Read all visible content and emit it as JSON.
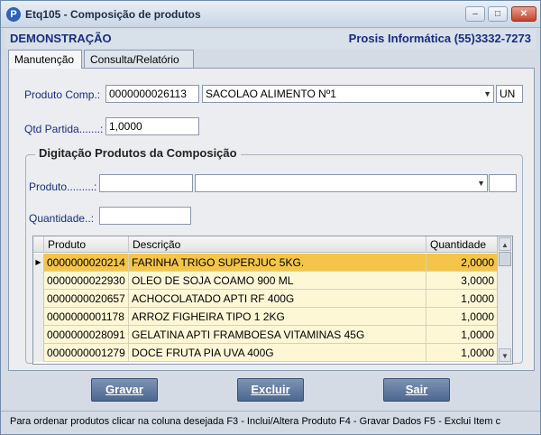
{
  "window": {
    "title": "Etq105 - Composição de produtos",
    "icon_letter": "P",
    "min": "–",
    "max": "□",
    "close": "✕"
  },
  "header": {
    "company": "DEMONSTRAÇÃO",
    "vendor": "Prosis Informática (55)3332-7273"
  },
  "tabs": [
    {
      "label": "Manutenção"
    },
    {
      "label": "Consulta/Relatório"
    }
  ],
  "form": {
    "produto_comp_label": "Produto Comp.:",
    "produto_comp_code": "0000000026113",
    "produto_comp_desc": "SACOLAO ALIMENTO Nº1",
    "produto_comp_unit": "UN",
    "qtd_partida_label": "Qtd Partida.......:",
    "qtd_partida_value": "1,0000"
  },
  "group": {
    "title": "Digitação Produtos da Composição",
    "produto_label": "Produto.........:",
    "produto_code": "",
    "produto_desc": "",
    "produto_unit": "",
    "quantidade_label": "Quantidade..:",
    "quantidade_value": ""
  },
  "grid": {
    "columns": [
      "Produto",
      "Descrição",
      "Quantidade"
    ],
    "rows": [
      {
        "code": "0000000020214",
        "desc": "FARINHA TRIGO SUPERJUC 5KG.",
        "qty": "2,0000",
        "selected": true
      },
      {
        "code": "0000000022930",
        "desc": "OLEO DE SOJA COAMO 900 ML",
        "qty": "3,0000"
      },
      {
        "code": "0000000020657",
        "desc": "ACHOCOLATADO APTI RF 400G",
        "qty": "1,0000"
      },
      {
        "code": "0000000001178",
        "desc": "ARROZ FIGHEIRA TIPO 1 2KG",
        "qty": "1,0000"
      },
      {
        "code": "0000000028091",
        "desc": "GELATINA APTI  FRAMBOESA VITAMINAS 45G",
        "qty": "1,0000"
      },
      {
        "code": "0000000001279",
        "desc": "DOCE FRUTA PIA UVA 400G",
        "qty": "1,0000"
      }
    ]
  },
  "buttons": {
    "gravar": "Gravar",
    "excluir": "Excluir",
    "sair": "Sair"
  },
  "status": "Para ordenar produtos clicar na coluna desejada  F3 - Inclui/Altera Produto     F4 - Gravar Dados   F5 - Exclui Item c",
  "colors": {
    "selected_row": "#f4c54a",
    "row_bg": "#fdf7d6",
    "label_blue": "#1b2d7a",
    "button": "#4d6790"
  }
}
